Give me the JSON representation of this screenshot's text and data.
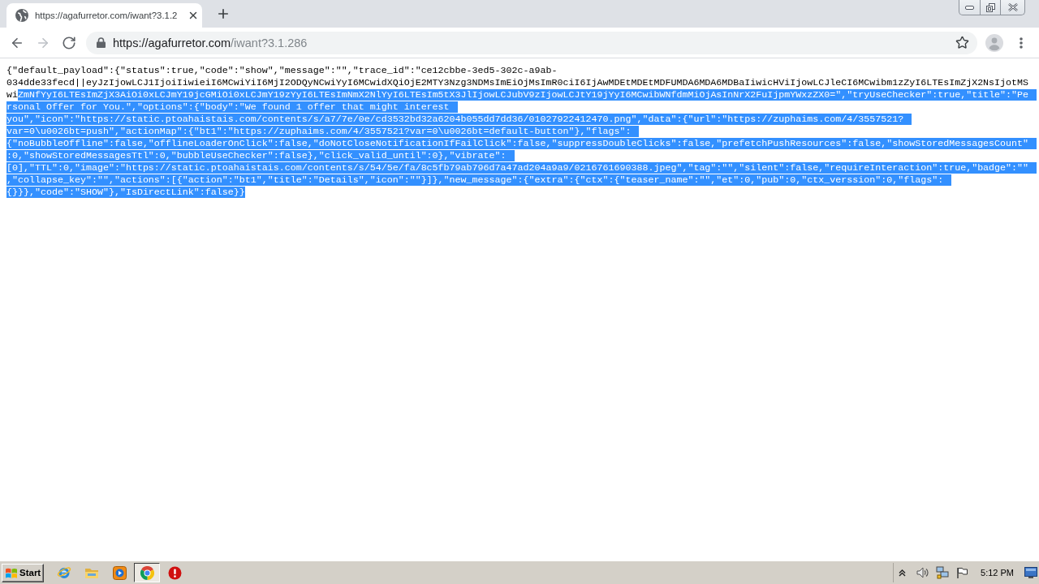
{
  "browser": {
    "tab": {
      "title": "https://agafurretor.com/iwant?3.1.2",
      "selected": true
    },
    "navigation": [
      {
        "kind": "back",
        "disabled": false
      },
      {
        "kind": "forward",
        "disabled": true
      },
      {
        "kind": "reload",
        "disabled": false
      }
    ],
    "address_bar": {
      "origin": "https://agafurretor.com",
      "path": "/iwant?3.1.286"
    }
  },
  "page": {
    "lines": [
      {
        "segments": [
          {
            "text": "{\"default_payload\":{\"status\":true,\"code\":\"show\",\"message\":\"\",\"trace_id\":\"ce12cbbe-3ed5-302c-a9ab-",
            "selected": false
          }
        ]
      },
      {
        "segments": [
          {
            "text": "034dde33fecd||eyJzIjowLCJ1IjoiIiwieiI6MCwiYiI6MjI2ODQyNCwiYyI6MCwidXQiOjE2MTY3Nzg3NDMsImEiOjMsImR0ciI6IjAwMDEtMDEtMDFUMDA6MDA6MDBaIiwicHViIjowLCJleCI6MCwibm1zZyI6LTEsImZjX2NsIjotMS",
            "selected": false
          }
        ]
      },
      {
        "segments": [
          {
            "text": "wi",
            "selected": false
          },
          {
            "text": "ZmNfYyI6LTEsImZjX3AiOi0xLCJmY19jcGMiOi0xLCJmY19zYyI6LTEsImNmX2NlYyI6LTEsIm5tX3JlIjowLCJubV9zIjowLCJtY19jYyI6MCwibWNfdmMiOjAsInNrX2FuIjpmYWxzZX0=\",\"tryUseChecker\":true,\"title\":\"Pe",
            "selected": true
          }
        ]
      },
      {
        "segments": [
          {
            "text": "rsonal Offer for You.\",\"options\":{\"body\":\"We found 1 offer that might interest",
            "selected": true
          }
        ]
      },
      {
        "segments": [
          {
            "text": "you\",\"icon\":\"https://static.ptoahaistais.com/contents/s/a7/7e/0e/cd3532bd32a6204b055dd7dd36/01027922412470.png\",\"data\":{\"url\":\"https://zuphaims.com/4/3557521?",
            "selected": true
          }
        ]
      },
      {
        "segments": [
          {
            "text": "var=0\\u0026bt=push\",\"actionMap\":{\"bt1\":\"https://zuphaims.com/4/3557521?var=0\\u0026bt=default-button\"},\"flags\":",
            "selected": true
          }
        ]
      },
      {
        "segments": [
          {
            "text": "{\"noBubbleOffline\":false,\"offlineLoaderOnClick\":false,\"doNotCloseNotificationIfFailClick\":false,\"suppressDoubleClicks\":false,\"prefetchPushResources\":false,\"showStoredMessagesCount\"",
            "selected": true
          }
        ]
      },
      {
        "segments": [
          {
            "text": ":0,\"showStoredMessagesTtl\":0,\"bubbleUseChecker\":false},\"click_valid_until\":0},\"vibrate\":",
            "selected": true
          }
        ]
      },
      {
        "segments": [
          {
            "text": "[0],\"TTL\":0,\"image\":\"https://static.ptoahaistais.com/contents/s/54/5e/fa/8c5fb79ab796d7a47ad204a9a9/0216761690388.jpeg\",\"tag\":\"\",\"silent\":false,\"requireInteraction\":true,\"badge\":\"\"",
            "selected": true
          }
        ]
      },
      {
        "segments": [
          {
            "text": ",\"collapse_key\":\"\",\"actions\":[{\"action\":\"bt1\",\"title\":\"Details\",\"icon\":\"\"}]},\"new_message\":{\"extra\":{\"ctx\":{\"teaser_name\":\"\",\"et\":0,\"pub\":0,\"ctx_verssion\":0,\"flags\":",
            "selected": true
          }
        ]
      },
      {
        "segments": [
          {
            "text": "{}}},\"code\":\"SHOW\"},\"IsDirectLink\":false}}",
            "selected": true
          }
        ]
      }
    ]
  },
  "taskbar": {
    "start_label": "Start",
    "apps": [
      {
        "kind": "globe-orbit",
        "selected": false
      },
      {
        "kind": "folder",
        "selected": false
      },
      {
        "kind": "media",
        "selected": false
      },
      {
        "kind": "tricolor",
        "selected": true
      },
      {
        "kind": "alert",
        "selected": false
      }
    ],
    "clock": "5:12 PM"
  }
}
